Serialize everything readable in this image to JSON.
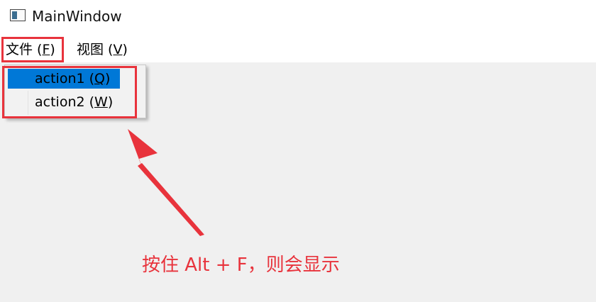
{
  "window": {
    "title": "MainWindow",
    "icon": "window-icon"
  },
  "menubar": {
    "items": [
      {
        "label": "文件 (F)",
        "mnemonic": "F"
      },
      {
        "label": "视图 (V)",
        "mnemonic": "V"
      }
    ]
  },
  "file_menu": {
    "items": [
      {
        "label": "action1 (Q)",
        "mnemonic": "Q",
        "highlighted": true
      },
      {
        "label": "action2 (W)",
        "mnemonic": "W",
        "highlighted": false
      }
    ]
  },
  "annotation": {
    "text": "按住 Alt + F，则会显示"
  },
  "colors": {
    "annotation_red": "#e8333c",
    "menu_highlight": "#0078d7",
    "content_background": "#f0f0f0"
  }
}
